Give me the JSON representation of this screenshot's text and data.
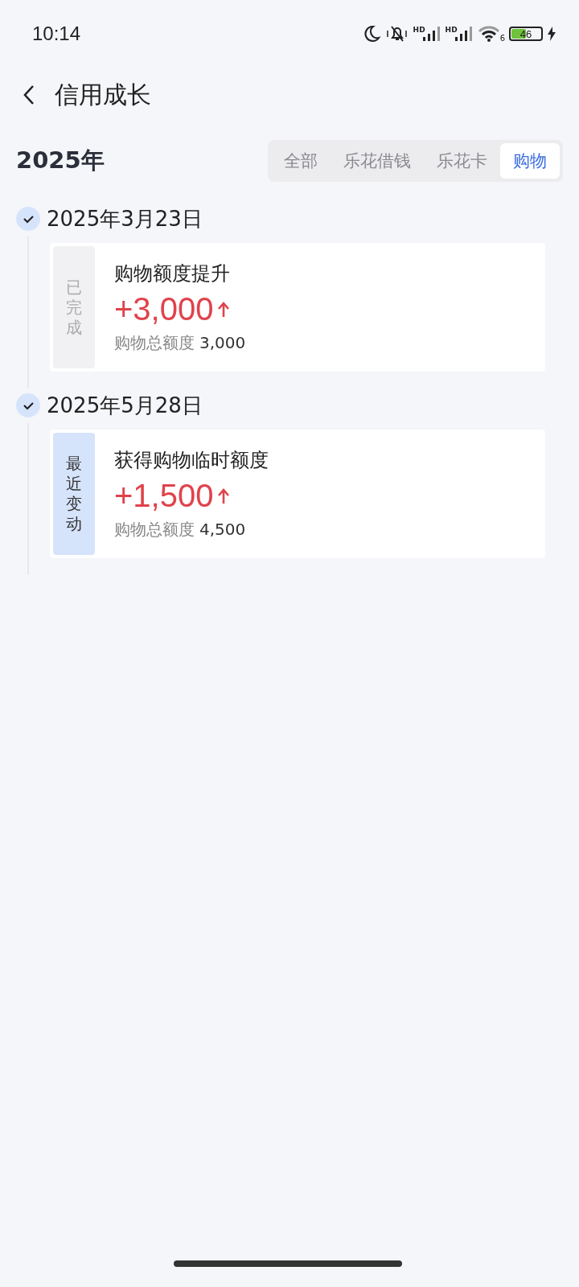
{
  "status_bar": {
    "time": "10:14",
    "signals": [
      "HD",
      "HD"
    ],
    "wifi_label": "6",
    "battery": "46"
  },
  "header": {
    "title": "信用成长"
  },
  "year": "2025年",
  "tabs": [
    {
      "label": "全部",
      "selected": false
    },
    {
      "label": "乐花借钱",
      "selected": false
    },
    {
      "label": "乐花卡",
      "selected": false
    },
    {
      "label": "购物",
      "selected": true
    }
  ],
  "timeline": [
    {
      "date": "2025年3月23日",
      "tag": "已完成",
      "kind": "done",
      "title": "购物额度提升",
      "amount": "+3,000",
      "total_label": "购物总额度",
      "total": "3,000"
    },
    {
      "date": "2025年5月28日",
      "tag": "最近变动",
      "kind": "recent",
      "title": "获得购物临时额度",
      "amount": "+1,500",
      "total_label": "购物总额度",
      "total": "4,500"
    }
  ]
}
